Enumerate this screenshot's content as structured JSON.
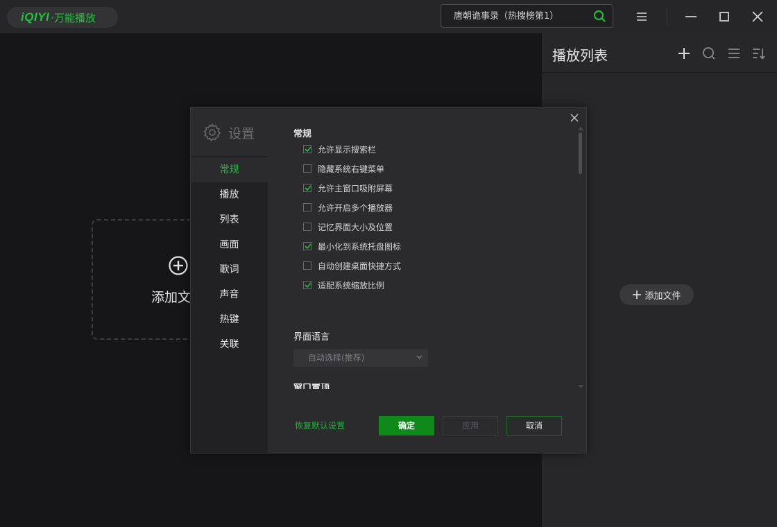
{
  "app": {
    "brand": "iQIYI",
    "brand_sub": "·万能播放",
    "accent_color": "#1ec43a"
  },
  "search": {
    "placeholder": "唐朝诡事录（热搜榜第1）",
    "icon": "search-icon"
  },
  "window_controls": [
    "menu-icon",
    "minimize-icon",
    "maximize-icon",
    "close-icon"
  ],
  "player": {
    "add_label": "添加文"
  },
  "playlist": {
    "title": "播放列表",
    "toolbar_icons": [
      "plus-icon",
      "search-icon",
      "list-icon",
      "sort-icon"
    ],
    "add_file_label": "添加文件"
  },
  "settings": {
    "title": "设置",
    "nav": [
      {
        "label": "常规",
        "active": true
      },
      {
        "label": "播放",
        "active": false
      },
      {
        "label": "列表",
        "active": false
      },
      {
        "label": "画面",
        "active": false
      },
      {
        "label": "歌词",
        "active": false
      },
      {
        "label": "声音",
        "active": false
      },
      {
        "label": "热键",
        "active": false
      },
      {
        "label": "关联",
        "active": false
      }
    ],
    "general": {
      "title": "常规",
      "options": [
        {
          "label": "允许显示搜索栏",
          "checked": true
        },
        {
          "label": "隐藏系统右键菜单",
          "checked": false
        },
        {
          "label": "允许主窗口吸附屏幕",
          "checked": true
        },
        {
          "label": "允许开启多个播放器",
          "checked": false
        },
        {
          "label": "记忆界面大小及位置",
          "checked": false
        },
        {
          "label": "最小化到系统托盘图标",
          "checked": true
        },
        {
          "label": "自动创建桌面快捷方式",
          "checked": false
        },
        {
          "label": "适配系统缩放比例",
          "checked": true
        }
      ]
    },
    "language": {
      "title": "界面语言",
      "selected": "自动选择(推荐)"
    },
    "next_section_title": "窗口置顶",
    "footer": {
      "restore_label": "恢复默认设置",
      "ok_label": "确定",
      "apply_label": "应用",
      "cancel_label": "取消"
    }
  }
}
